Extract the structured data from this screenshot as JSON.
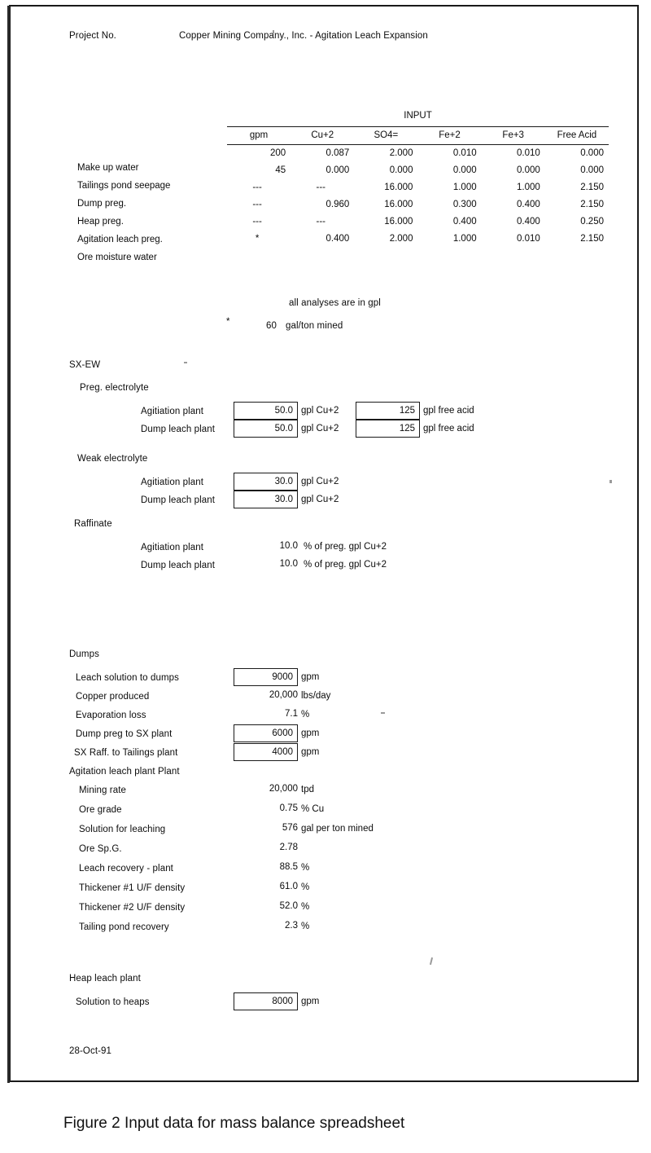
{
  "header": {
    "project_no_label": "Project No.",
    "document_title": "Copper Mining Company., Inc. - Agitation Leach Expansion"
  },
  "input_table": {
    "caption": "INPUT",
    "columns": [
      "gpm",
      "Cu+2",
      "SO4=",
      "Fe+2",
      "Fe+3",
      "Free Acid"
    ],
    "rows": [
      {
        "label": "Make up water",
        "cells": [
          "200",
          "0.087",
          "2.000",
          "0.010",
          "0.010",
          "0.000"
        ]
      },
      {
        "label": "Tailings pond seepage",
        "cells": [
          "45",
          "0.000",
          "0.000",
          "0.000",
          "0.000",
          "0.000"
        ]
      },
      {
        "label": "Dump preg.",
        "cells": [
          "---",
          "---",
          "16.000",
          "1.000",
          "1.000",
          "2.150"
        ]
      },
      {
        "label": "Heap preg.",
        "cells": [
          "---",
          "0.960",
          "16.000",
          "0.300",
          "0.400",
          "2.150"
        ]
      },
      {
        "label": "Agitation leach preg.",
        "cells": [
          "---",
          "---",
          "16.000",
          "0.400",
          "0.400",
          "0.250"
        ]
      },
      {
        "label": "Ore moisture water",
        "cells": [
          "*",
          "0.400",
          "2.000",
          "1.000",
          "0.010",
          "2.150"
        ]
      }
    ],
    "notes": {
      "analyses": "all analyses  are in gpl",
      "star_marker": "*",
      "gal_per_ton_value": "60",
      "gal_per_ton_unit": "gal/ton mined"
    }
  },
  "sxew": {
    "heading": "SX-EW",
    "groups": [
      {
        "title": "Preg. electrolyte",
        "rows": [
          {
            "label": "Agitiation plant",
            "value1": "50.0",
            "unit1": "gpl Cu+2",
            "value2": "125",
            "unit2": "gpl free acid"
          },
          {
            "label": "Dump leach plant",
            "value1": "50.0",
            "unit1": "gpl Cu+2",
            "value2": "125",
            "unit2": "gpl free acid"
          }
        ]
      },
      {
        "title": "Weak electrolyte",
        "rows": [
          {
            "label": "Agitiation plant",
            "value1": "30.0",
            "unit1": "gpl Cu+2"
          },
          {
            "label": "Dump leach plant",
            "value1": "30.0",
            "unit1": "gpl Cu+2"
          }
        ]
      },
      {
        "title": "Raffinate",
        "rows": [
          {
            "label": "Agitiation plant",
            "value1": "10.0",
            "unit1": "% of preg. gpl Cu+2"
          },
          {
            "label": "Dump leach plant",
            "value1": "10.0",
            "unit1": "% of preg. gpl Cu+2"
          }
        ]
      }
    ]
  },
  "dumps": {
    "heading": "Dumps",
    "rows": [
      {
        "label": "Leach solution to dumps",
        "value": "9000",
        "unit": "gpm",
        "boxed": true
      },
      {
        "label": "Copper produced",
        "value": "20,000",
        "unit": "lbs/day",
        "boxed": false
      },
      {
        "label": "Evaporation loss",
        "value": "7.1",
        "unit": "%",
        "boxed": false
      },
      {
        "label": "Dump preg to SX plant",
        "value": "6000",
        "unit": "gpm",
        "boxed": true
      },
      {
        "label": "SX Raff. to Tailings plant",
        "value": "4000",
        "unit": "gpm",
        "boxed": true
      }
    ]
  },
  "agitation_plant": {
    "heading": "Agitation leach plant Plant",
    "rows": [
      {
        "label": "Mining rate",
        "value": "20,000",
        "unit": "tpd"
      },
      {
        "label": "Ore grade",
        "value": "0.75",
        "unit": "% Cu"
      },
      {
        "label": "Solution for leaching",
        "value": "576",
        "unit": "gal per ton mined"
      },
      {
        "label": "Ore Sp.G.",
        "value": "2.78",
        "unit": ""
      },
      {
        "label": "Leach recovery - plant",
        "value": "88.5",
        "unit": "%"
      },
      {
        "label": "Thickener #1 U/F density",
        "value": "61.0",
        "unit": "%"
      },
      {
        "label": "Thickener #2 U/F density",
        "value": "52.0",
        "unit": "%"
      },
      {
        "label": "Tailing pond recovery",
        "value": "2.3",
        "unit": "%"
      }
    ]
  },
  "heap_plant": {
    "heading": "Heap leach plant",
    "rows": [
      {
        "label": "Solution to heaps",
        "value": "8000",
        "unit": "gpm",
        "boxed": true
      }
    ]
  },
  "footer": {
    "date": "28-Oct-91"
  },
  "figure": {
    "caption": "Figure 2  Input data for mass balance spreadsheet"
  }
}
